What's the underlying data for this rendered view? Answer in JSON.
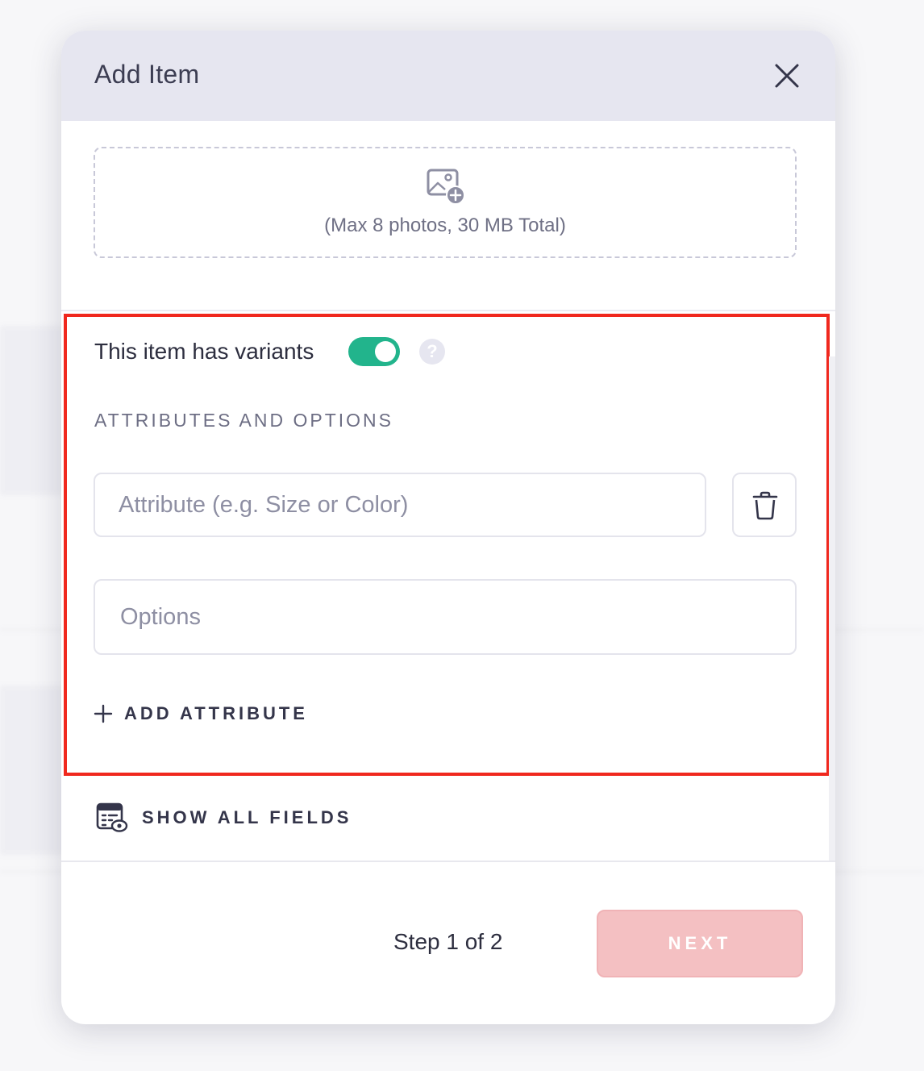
{
  "modal": {
    "title": "Add Item",
    "upload": {
      "hint": "(Max 8 photos, 30 MB Total)"
    },
    "variants": {
      "label": "This item has variants",
      "toggle_on": true,
      "help_glyph": "?"
    },
    "attributes": {
      "heading": "ATTRIBUTES AND OPTIONS",
      "attribute_placeholder": "Attribute (e.g. Size or Color)",
      "attribute_value": "",
      "options_placeholder": "Options",
      "options_value": "",
      "add_label": "ADD ATTRIBUTE"
    },
    "show_all_fields_label": "SHOW ALL FIELDS",
    "footer": {
      "step_text": "Step 1 of 2",
      "next_label": "NEXT"
    }
  },
  "icons": {
    "close": "close-icon",
    "upload": "image-add-icon",
    "help": "question-icon",
    "delete": "trash-icon",
    "add": "plus-icon",
    "show_all": "calendar-eye-icon"
  },
  "colors": {
    "header_bg": "#e6e6f0",
    "toggle_on": "#22b48c",
    "next_disabled": "#f4c0c2",
    "highlight_border": "#f0281e"
  }
}
